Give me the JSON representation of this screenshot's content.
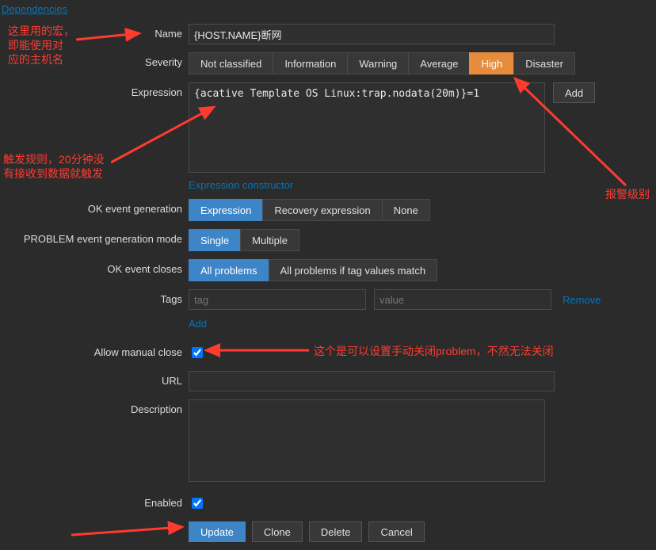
{
  "tab": "Dependencies",
  "labels": {
    "name": "Name",
    "severity": "Severity",
    "expression": "Expression",
    "ok_gen": "OK event generation",
    "problem_mode": "PROBLEM event generation mode",
    "ok_closes": "OK event closes",
    "tags": "Tags",
    "manual_close": "Allow manual close",
    "url": "URL",
    "description": "Description",
    "enabled": "Enabled"
  },
  "name_value": "{HOST.NAME}断网",
  "severity_options": [
    "Not classified",
    "Information",
    "Warning",
    "Average",
    "High",
    "Disaster"
  ],
  "severity_selected": "High",
  "expression_value": "{acative Template OS Linux:trap.nodata(20m)}=1",
  "add_btn": "Add",
  "expression_constructor": "Expression constructor",
  "ok_gen_options": [
    "Expression",
    "Recovery expression",
    "None"
  ],
  "ok_gen_selected": "Expression",
  "problem_mode_options": [
    "Single",
    "Multiple"
  ],
  "problem_mode_selected": "Single",
  "ok_closes_options": [
    "All problems",
    "All problems if tag values match"
  ],
  "ok_closes_selected": "All problems",
  "tag_placeholder": "tag",
  "value_placeholder": "value",
  "remove_link": "Remove",
  "add_link": "Add",
  "manual_close_checked": true,
  "url_value": "",
  "description_value": "",
  "enabled_checked": true,
  "buttons": {
    "update": "Update",
    "clone": "Clone",
    "delete": "Delete",
    "cancel": "Cancel"
  },
  "annotations": {
    "a1": "这里用的宏，\n即能使用对\n应的主机名",
    "a2": "触发规则，20分钟没\n有接收到数据就触发",
    "a3": "报警级别",
    "a4": "这个是可以设置手动关闭problem，不然无法关闭"
  }
}
